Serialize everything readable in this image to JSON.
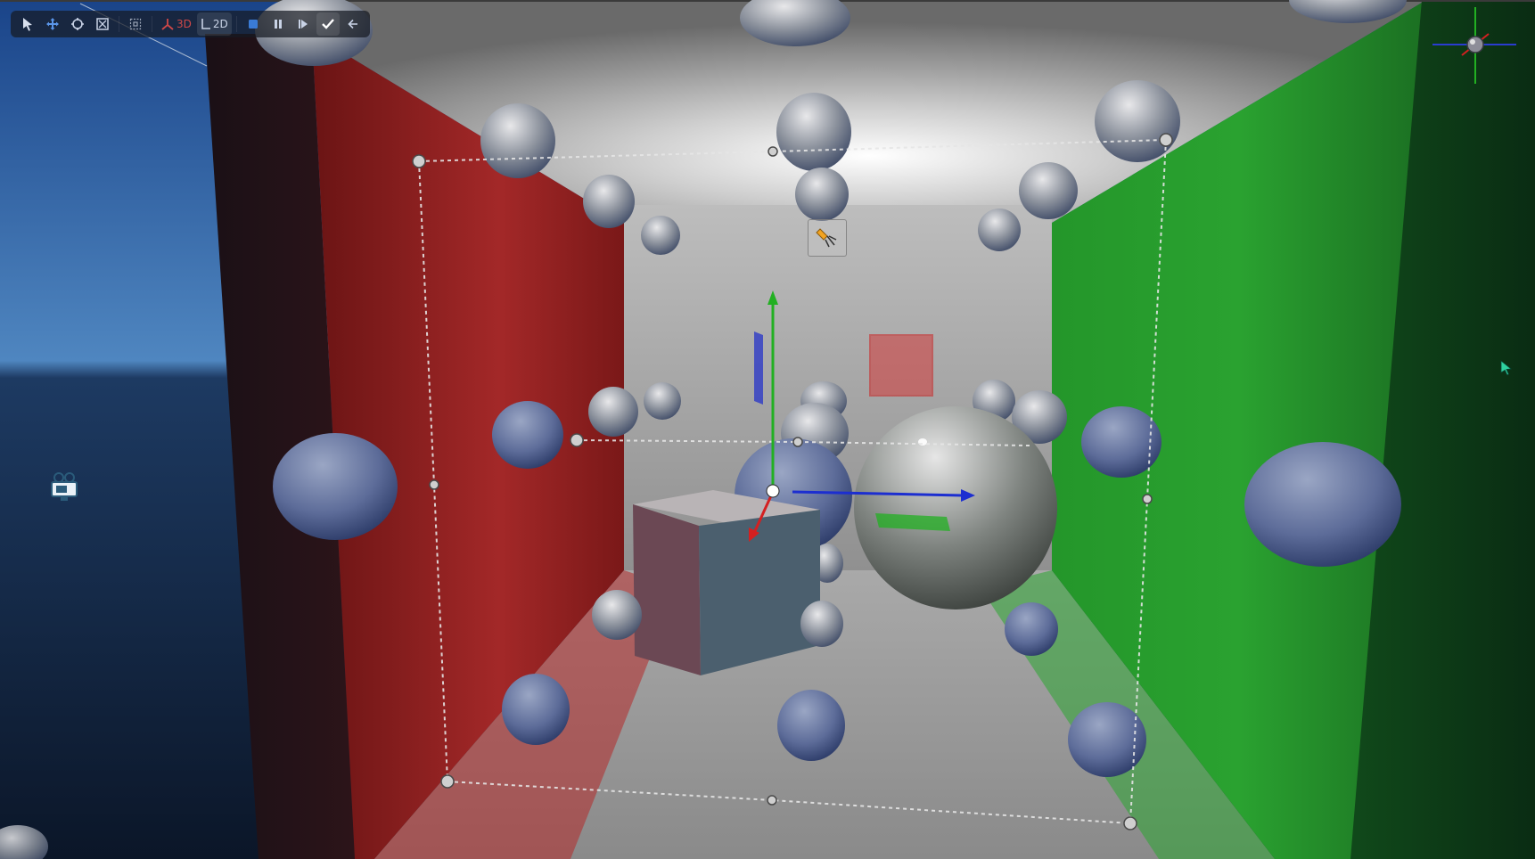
{
  "toolbar": {
    "tools": [
      {
        "name": "select-tool",
        "icon": "cursor-arrow-icon"
      },
      {
        "name": "move-tool",
        "icon": "move-arrows-icon"
      },
      {
        "name": "rotate-tool",
        "icon": "rotate-icon"
      },
      {
        "name": "scale-tool",
        "icon": "scale-icon"
      },
      {
        "name": "rect-tool",
        "icon": "rect-select-icon"
      }
    ],
    "mode_3d_label": "3D",
    "mode_2d_label": "2D",
    "playback": [
      "stop",
      "pause",
      "step"
    ],
    "confirm_icon": "checkmark-icon",
    "back_icon": "arrow-left-icon"
  },
  "colors": {
    "toolbar_icon": "#c9d3e6",
    "accent_blue": "#3a7bd5",
    "mode_3d": "#d04848",
    "wall_left": "#a82828",
    "wall_right": "#24a82a",
    "gizmo_x": "#d42020",
    "gizmo_y": "#22b022",
    "gizmo_z": "#1c2ed0",
    "sky_top": "#1f4c92",
    "ocean": "#0d1b30"
  },
  "overlays": {
    "camera_icon": "video-camera-icon",
    "light_icon": "spot-light-icon",
    "view_gizmo": "orientation-gizmo-icon",
    "cursor": "mouse-cursor-icon"
  }
}
